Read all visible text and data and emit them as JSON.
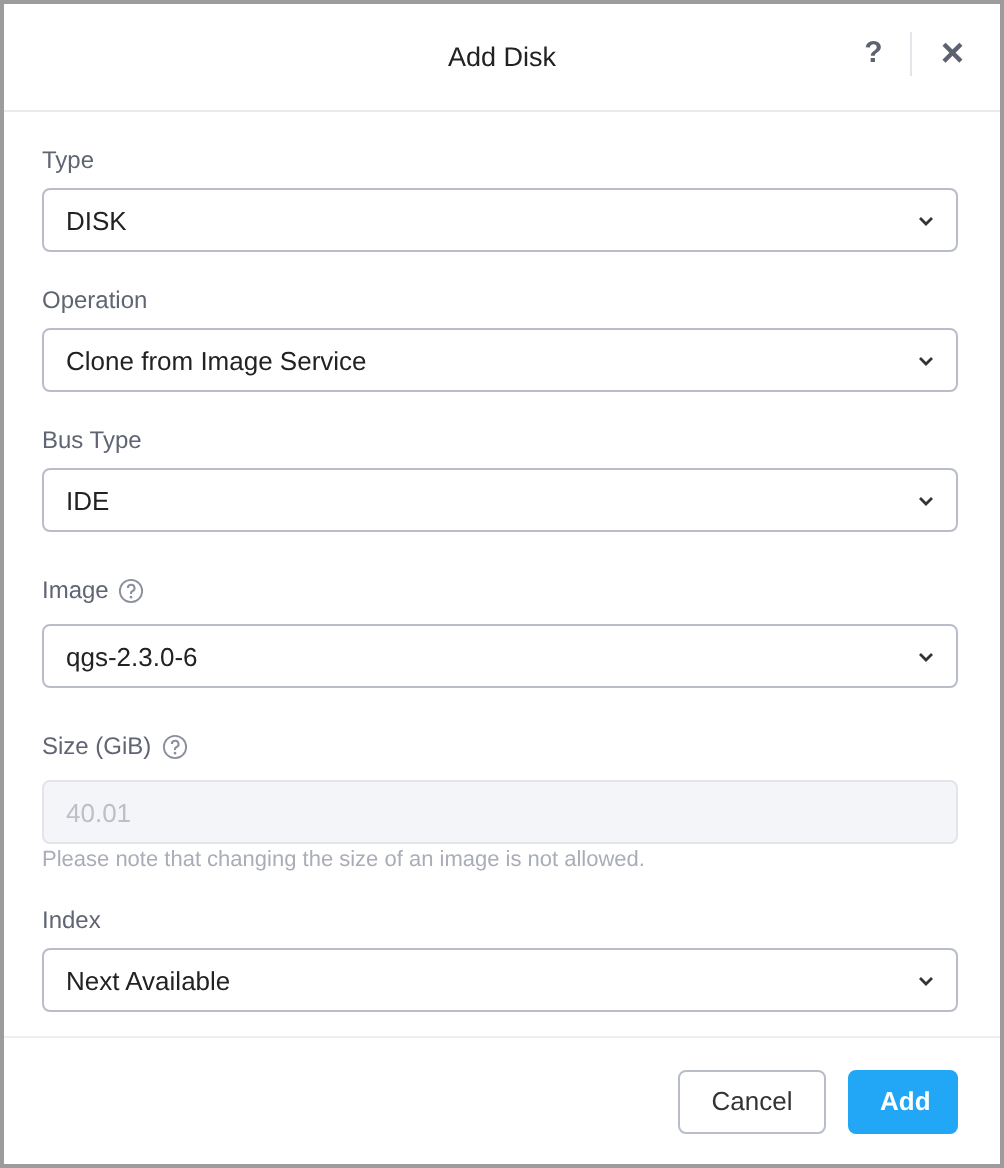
{
  "dialog": {
    "title": "Add Disk",
    "help": "?",
    "close": "×"
  },
  "fields": [
    {
      "kind": "select",
      "label": "Type",
      "has_help": false,
      "value": "DISK",
      "disabled": false
    },
    {
      "kind": "select",
      "label": "Operation",
      "has_help": false,
      "value": "Clone from Image Service",
      "disabled": false
    },
    {
      "kind": "select",
      "label": "Bus Type",
      "has_help": false,
      "value": "IDE",
      "disabled": false
    },
    {
      "kind": "select",
      "label": "Image",
      "has_help": true,
      "value": "qgs-2.3.0-6",
      "disabled": false
    },
    {
      "kind": "text",
      "label": "Size (GiB)",
      "has_help": true,
      "value": "40.01",
      "disabled": true,
      "note": "Please note that changing the size of an image is not allowed."
    },
    {
      "kind": "select",
      "label": "Index",
      "has_help": false,
      "value": "Next Available",
      "disabled": false
    }
  ],
  "buttons": [
    {
      "label": "Cancel",
      "kind": "secondary"
    },
    {
      "label": "Add",
      "kind": "primary"
    }
  ]
}
